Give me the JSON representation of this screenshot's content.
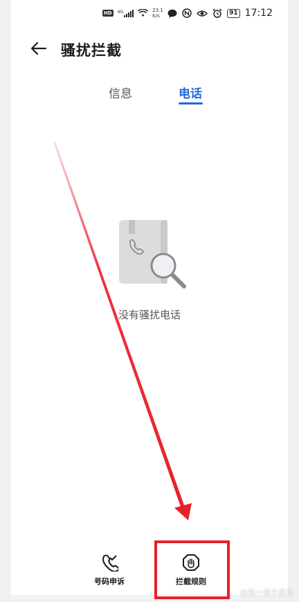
{
  "status_bar": {
    "hd": "HD",
    "network": "4G",
    "speed_value": "23.1",
    "speed_unit": "K/s",
    "battery": "91",
    "time": "17:12"
  },
  "header": {
    "title": "骚扰拦截"
  },
  "tabs": [
    {
      "label": "信息",
      "active": false
    },
    {
      "label": "电话",
      "active": true
    }
  ],
  "empty_state": {
    "text": "没有骚扰电话"
  },
  "bottom_nav": {
    "items": [
      {
        "label": "号码申诉",
        "icon": "phone-appeal-icon"
      },
      {
        "label": "拦截规则",
        "icon": "hand-stop-icon"
      }
    ]
  },
  "annotation": {
    "color": "#e8202a"
  },
  "watermark": "@揽一袋子星星",
  "colors": {
    "accent": "#1e6ad6"
  }
}
